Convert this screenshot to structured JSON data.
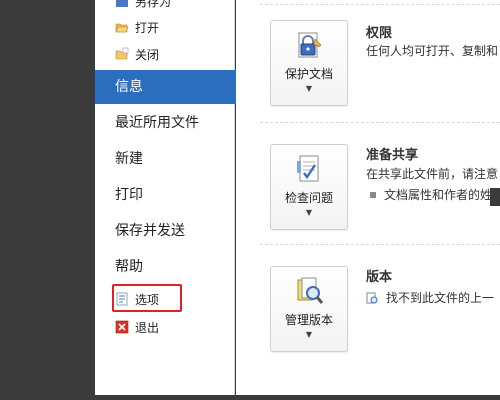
{
  "sidebar": {
    "top_partial_label": "另存为",
    "open_label": "打开",
    "close_label": "关闭",
    "info_label": "信息",
    "recent_label": "最近所用文件",
    "new_label": "新建",
    "print_label": "打印",
    "save_send_label": "保存并发送",
    "help_label": "帮助",
    "options_label": "选项",
    "exit_label": "退出"
  },
  "sections": {
    "permissions": {
      "button_label": "保护文档",
      "title": "权限",
      "desc": "任何人均可打开、复制和"
    },
    "prepare": {
      "button_label": "检查问题",
      "title": "准备共享",
      "desc": "在共享此文件前，请注意",
      "bullet": "文档属性和作者的姓"
    },
    "versions": {
      "button_label": "管理版本",
      "title": "版本",
      "desc": "找不到此文件的上一"
    }
  },
  "colors": {
    "accent": "#2a6ebd",
    "highlight": "#e0202a"
  }
}
